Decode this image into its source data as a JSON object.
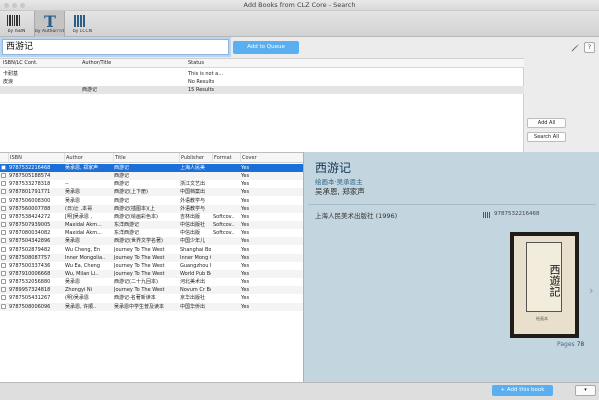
{
  "window": {
    "title": "Add Books from CLZ Core - Search"
  },
  "toolbar": {
    "tabs": [
      {
        "label": "by ISBN",
        "icon": "barcode-icon"
      },
      {
        "label": "by Author/Title",
        "icon": "letter-t-icon"
      },
      {
        "label": "by LCCN",
        "icon": "book-stack-icon"
      }
    ]
  },
  "search": {
    "value": "西游记",
    "queue_button": "Add to Queue",
    "help": "?"
  },
  "queue": {
    "columns": [
      "ISBN/LC Cont.",
      "Author/Title",
      "Status"
    ],
    "rows": [
      {
        "isbn": "卡耐基",
        "title": "",
        "status": "This is not a..."
      },
      {
        "isbn": "皮浪",
        "title": "",
        "status": "No Results"
      },
      {
        "isbn": "",
        "title": "西游记",
        "status": "15 Results"
      }
    ]
  },
  "side": {
    "add_all": "Add All",
    "search_all": "Search All"
  },
  "results": {
    "columns": [
      "ISBN",
      "Author",
      "Title",
      "Publisher",
      "Format",
      "Cover"
    ],
    "rows": [
      {
        "isbn": "9787532216468",
        "author": "吴承恩, 郑家声",
        "title": "西游记",
        "publisher": "上海人民美",
        "format": "",
        "cover": "Yes"
      },
      {
        "isbn": "9787505188574",
        "author": "",
        "title": "西游记",
        "publisher": "",
        "format": "",
        "cover": "Yes"
      },
      {
        "isbn": "9787533278318",
        "author": "--",
        "title": "西游记",
        "publisher": "浙江文艺出",
        "format": "",
        "cover": "Yes"
      },
      {
        "isbn": "9787801791771",
        "author": "吴承恩",
        "title": "西游记(上下册)",
        "publisher": "中国档案出",
        "format": "",
        "cover": "Yes"
      },
      {
        "isbn": "9787506008300",
        "author": "吴承恩",
        "title": "西游记",
        "publisher": "外语教学与",
        "format": "",
        "cover": "Yes"
      },
      {
        "isbn": "9787560007788",
        "author": "(日)辻 ,本哥",
        "title": "西游记(插图本)(上",
        "publisher": "外语教学与",
        "format": "",
        "cover": "Yes"
      },
      {
        "isbn": "9787538424272",
        "author": "[明]吴承恩 ,",
        "title": "西游记(绘画彩色本)",
        "publisher": "吉林出版",
        "format": "Softcov..",
        "cover": "Yes"
      },
      {
        "isbn": "9787507939005",
        "author": "Maxidal Akm...",
        "title": "东洋西游记",
        "publisher": "中信出版社",
        "format": "Softcov..",
        "cover": "Yes"
      },
      {
        "isbn": "9787080034082",
        "author": "Maxidal Akm...",
        "title": "东洋西游记",
        "publisher": "中信出版",
        "format": "Softcov..",
        "cover": "Yes"
      },
      {
        "isbn": "9787504342896",
        "author": "吴承恩",
        "title": "西游记(世界文学名著)",
        "publisher": "中国少年儿",
        "format": "",
        "cover": "Yes"
      },
      {
        "isbn": "9787502879482",
        "author": "Wu Cheng, En",
        "title": "Journey To The West",
        "publisher": "Shanghai Book ..",
        "format": "",
        "cover": "Yes"
      },
      {
        "isbn": "9787508087757",
        "author": "Inner Mongolia..",
        "title": "Journey To The West",
        "publisher": "Inner Mong Comics",
        "format": "",
        "cover": "Yes"
      },
      {
        "isbn": "9787500337436",
        "author": "Wu Ea, Cheng",
        "title": "Journey To The West",
        "publisher": "Guangzhou Book ..",
        "format": "",
        "cover": "Yes"
      },
      {
        "isbn": "9787910006668",
        "author": "Wu, Milan Li..",
        "title": "Journey To The West",
        "publisher": "World Pub Book ..",
        "format": "",
        "cover": "Yes"
      },
      {
        "isbn": "9787532056880",
        "author": "吴承恩",
        "title": "西游记(二十九回本)",
        "publisher": "河北美术出",
        "format": "",
        "cover": "Yes"
      },
      {
        "isbn": "9789957324818",
        "author": "Zhongyi Ni",
        "title": "Journey To The West",
        "publisher": "Novum Cr Book ..",
        "format": "",
        "cover": "Yes"
      },
      {
        "isbn": "9787505431267",
        "author": "(明)吴承恩",
        "title": "西游记-名著新读本",
        "publisher": "京华出版社",
        "format": "",
        "cover": "Yes"
      },
      {
        "isbn": "9787508006096",
        "author": "吴承恩, 许顺..",
        "title": "吴承恩中学生普及读本",
        "publisher": "中国华侨出",
        "format": "",
        "cover": "Yes"
      }
    ]
  },
  "detail": {
    "title": "西游记",
    "subtitle": "绘画本·吴承恩主",
    "authors": "吴承恩, 郑家声",
    "publisher_line": "上海人民美术出版社 (1996)",
    "isbn": "9787532216468",
    "cover_text": "西遊記",
    "cover_sub": "绘画本",
    "pages_label": "Pages",
    "pages_value": "78"
  },
  "footer": {
    "add_button": "+ Add this book",
    "dropdown": "▾"
  }
}
